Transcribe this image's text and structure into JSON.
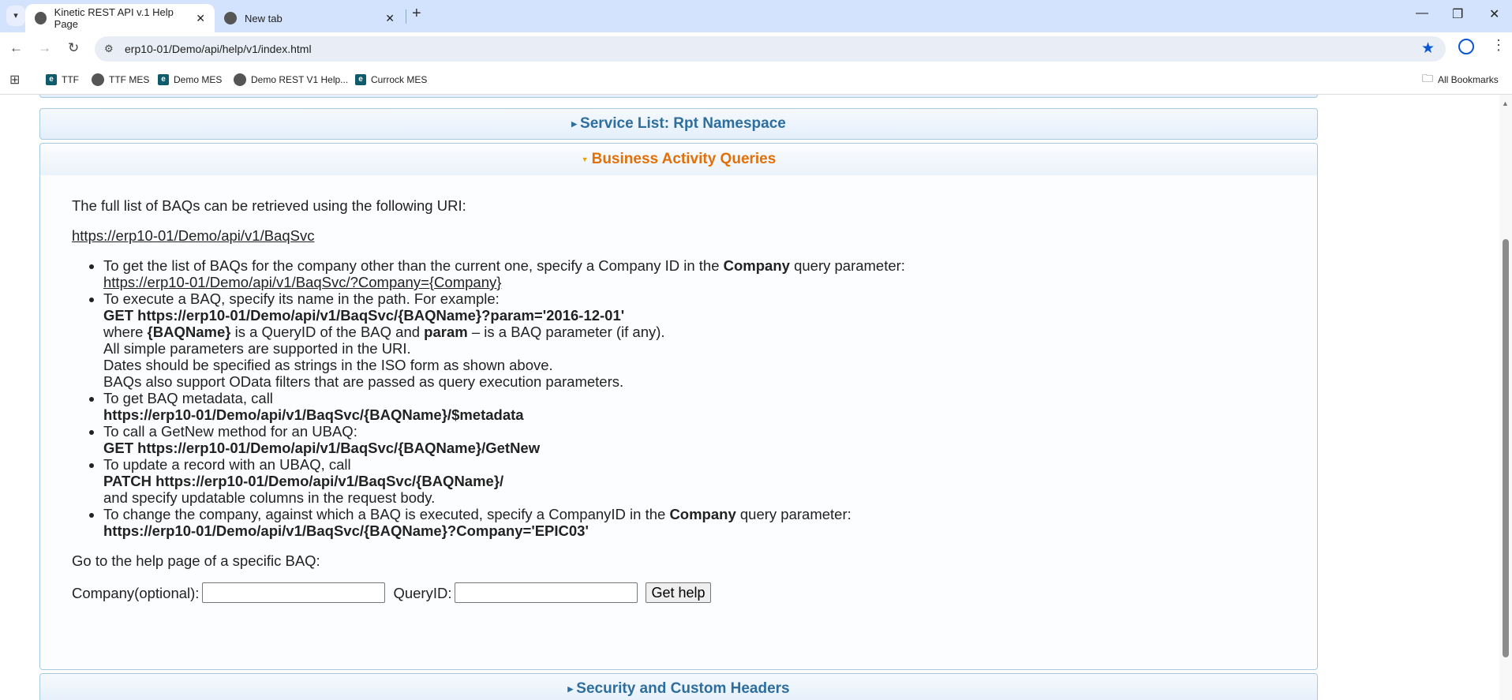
{
  "browser": {
    "tabs": [
      {
        "title": "Kinetic REST API v.1 Help Page",
        "active": true
      },
      {
        "title": "New tab",
        "active": false
      }
    ],
    "url": "erp10-01/Demo/api/help/v1/index.html",
    "bookmarks": [
      {
        "label": "TTF",
        "icon": "e-icon"
      },
      {
        "label": "TTF MES",
        "icon": "globe-icon"
      },
      {
        "label": "Demo MES",
        "icon": "e-icon"
      },
      {
        "label": "Demo REST V1 Help...",
        "icon": "globe-icon"
      },
      {
        "label": "Currock MES",
        "icon": "e-icon"
      }
    ],
    "all_bookmarks": "All Bookmarks"
  },
  "sections": {
    "rpt": "Service List: Rpt Namespace",
    "baq": "Business Activity Queries",
    "security": "Security and Custom Headers"
  },
  "baq": {
    "intro": "The full list of BAQs can be retrieved using the following URI:",
    "uri": "https://erp10-01/Demo/api/v1/BaqSvc",
    "b1a": "To get the list of BAQs for the company other than the current one, specify a Company ID in the ",
    "b1b": "Company",
    "b1c": " query parameter:",
    "b1link": "https://erp10-01/Demo/api/v1/BaqSvc/?Company={Company}",
    "b2a": "To execute a BAQ, specify its name in the path. For example:",
    "b2b": "GET https://erp10-01/Demo/api/v1/BaqSvc/{BAQName}?param='2016-12-01'",
    "b2c": "where ",
    "b2d": "{BAQName}",
    "b2e": " is a QueryID of the BAQ and ",
    "b2f": "param",
    "b2g": " – is a BAQ parameter (if any).",
    "b2h": "All simple parameters are supported in the URI.",
    "b2i": "Dates should be specified as strings in the ISO form as shown above.",
    "b2j": "BAQs also support OData filters that are passed as query execution parameters.",
    "b3a": "To get BAQ metadata, call",
    "b3b": "https://erp10-01/Demo/api/v1/BaqSvc/{BAQName}/$metadata",
    "b4a": "To call a GetNew method for an UBAQ:",
    "b4b": "GET https://erp10-01/Demo/api/v1/BaqSvc/{BAQName}/GetNew",
    "b5a": "To update a record with an UBAQ, call",
    "b5b": "PATCH https://erp10-01/Demo/api/v1/BaqSvc/{BAQName}/",
    "b5c": "and specify updatable columns in the request body.",
    "b6a": "To change the company, against which a BAQ is executed, specify a CompanyID in the ",
    "b6b": "Company",
    "b6c": " query parameter:",
    "b6d": "https://erp10-01/Demo/api/v1/BaqSvc/{BAQName}?Company='EPIC03'",
    "goto": "Go to the help page of a specific BAQ:",
    "company_label": "Company(optional):",
    "company_value": "",
    "query_label": "QueryID:",
    "query_value": "",
    "get_help": "Get help"
  }
}
